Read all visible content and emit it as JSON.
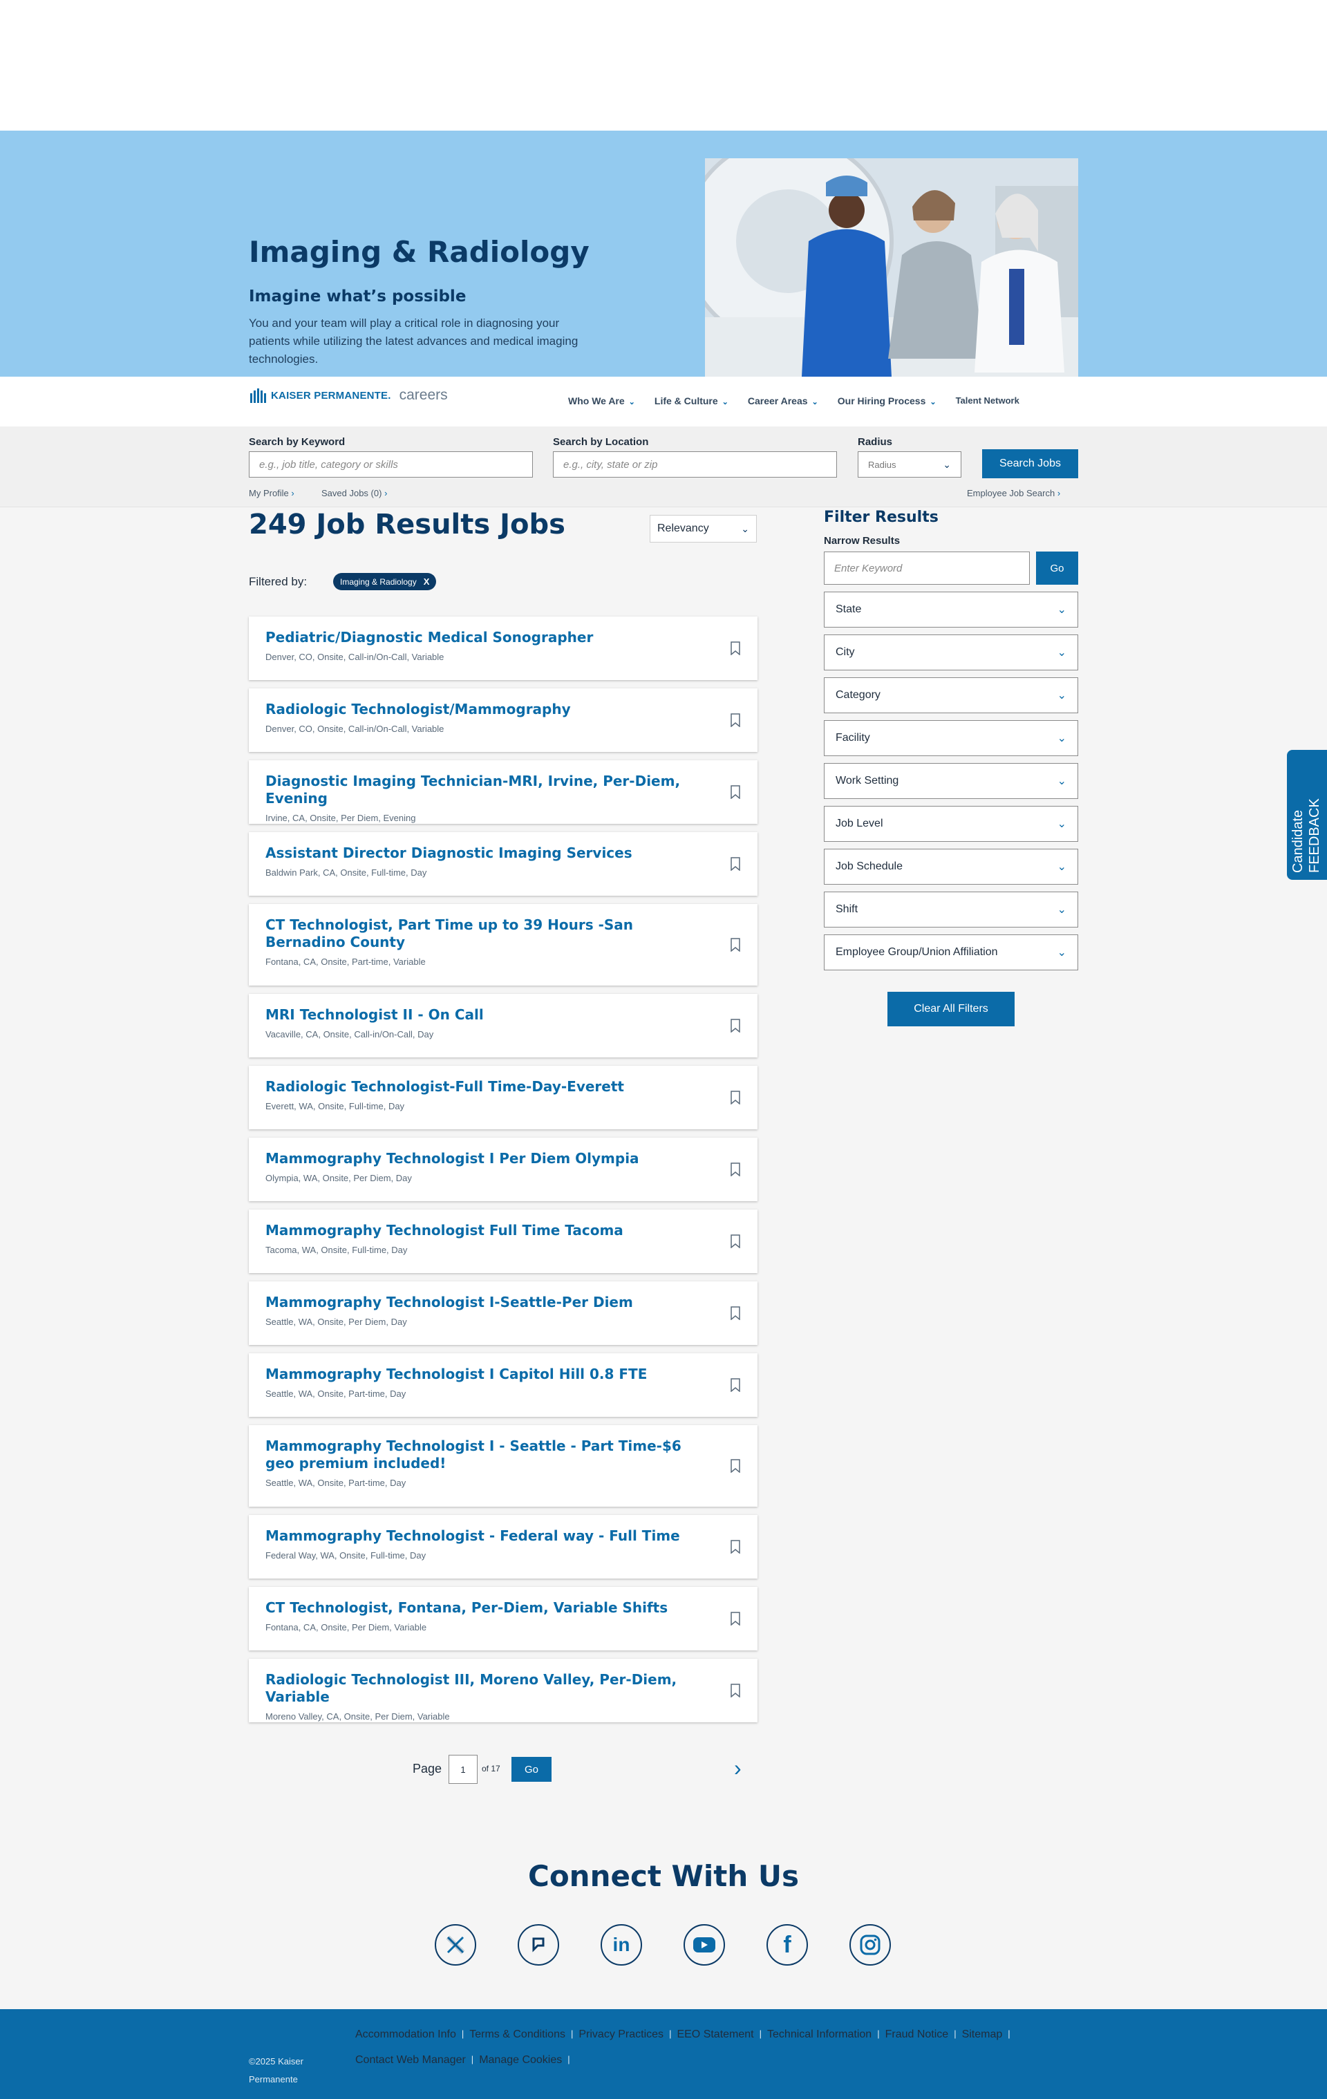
{
  "hero": {
    "title": "Imaging & Radiology",
    "subtitle": "Imagine what’s possible",
    "description": "You and your team will play a critical role in diagnosing your patients while utilizing the latest advances and medical imaging technologies."
  },
  "nav": {
    "logo_text": "KAISER PERMANENTE.",
    "logo_suffix": "careers",
    "links": [
      "Who We Are",
      "Life & Culture",
      "Career Areas",
      "Our Hiring Process",
      "Talent Network"
    ]
  },
  "search": {
    "keyword_label": "Search by Keyword",
    "keyword_placeholder": "e.g., job title, category or skills",
    "location_label": "Search by Location",
    "location_placeholder": "e.g., city, state or zip",
    "radius_label": "Radius",
    "radius_value": "Radius",
    "button": "Search Jobs",
    "my_profile": "My Profile",
    "saved_jobs": "Saved Jobs (0)",
    "employee_search": "Employee Job Search"
  },
  "results": {
    "heading": "249 Job Results Jobs",
    "sort_value": "Relevancy",
    "filtered_by": "Filtered by:",
    "chip": "Imaging & Radiology",
    "chip_close": "X"
  },
  "jobs": [
    {
      "title": "Pediatric/Diagnostic Medical Sonographer",
      "meta": "Denver, CO, Onsite, Call-in/On-Call, Variable"
    },
    {
      "title": "Radiologic Technologist/Mammography",
      "meta": "Denver, CO, Onsite, Call-in/On-Call, Variable"
    },
    {
      "title": "Diagnostic Imaging Technician-MRI, Irvine, Per-Diem, Evening",
      "meta": "Irvine, CA, Onsite, Per Diem, Evening"
    },
    {
      "title": "Assistant Director Diagnostic Imaging Services",
      "meta": "Baldwin Park, CA, Onsite, Full-time, Day"
    },
    {
      "title": "CT Technologist, Part Time up to 39 Hours -San Bernadino County",
      "meta": "Fontana, CA, Onsite, Part-time, Variable"
    },
    {
      "title": "MRI Technologist II - On Call",
      "meta": "Vacaville, CA, Onsite, Call-in/On-Call, Day"
    },
    {
      "title": "Radiologic Technologist-Full Time-Day-Everett",
      "meta": "Everett, WA, Onsite, Full-time, Day"
    },
    {
      "title": "Mammography Technologist I Per Diem Olympia",
      "meta": "Olympia, WA, Onsite, Per Diem, Day"
    },
    {
      "title": "Mammography Technologist Full Time Tacoma",
      "meta": "Tacoma, WA, Onsite, Full-time, Day"
    },
    {
      "title": "Mammography Technologist I-Seattle-Per Diem",
      "meta": "Seattle, WA, Onsite, Per Diem, Day"
    },
    {
      "title": "Mammography Technologist I Capitol Hill 0.8 FTE",
      "meta": "Seattle, WA, Onsite, Part-time, Day"
    },
    {
      "title": "Mammography Technologist I - Seattle - Part Time-$6 geo premium included!",
      "meta": "Seattle, WA, Onsite, Part-time, Day"
    },
    {
      "title": "Mammography Technologist - Federal way - Full Time",
      "meta": "Federal Way, WA, Onsite, Full-time, Day"
    },
    {
      "title": "CT Technologist, Fontana, Per-Diem, Variable Shifts",
      "meta": "Fontana, CA, Onsite, Per Diem, Variable"
    },
    {
      "title": "Radiologic Technologist III, Moreno Valley, Per-Diem, Variable",
      "meta": "Moreno Valley, CA, Onsite, Per Diem, Variable"
    }
  ],
  "pagination": {
    "label": "Page",
    "value": "1",
    "of": "of 17",
    "go": "Go"
  },
  "filters": {
    "title": "Filter Results",
    "narrow": "Narrow Results",
    "keyword_placeholder": "Enter Keyword",
    "go": "Go",
    "dropdowns": [
      "State",
      "City",
      "Category",
      "Facility",
      "Work Setting",
      "Job Level",
      "Job Schedule",
      "Shift",
      "Employee Group/Union Affiliation"
    ],
    "clear": "Clear All Filters"
  },
  "feedback": {
    "line1": "Candidate",
    "line2": "FEEDBACK",
    "icon": "[…]"
  },
  "connect": {
    "title": "Connect With Us",
    "icons": [
      "x-icon",
      "glassdoor-icon",
      "linkedin-icon",
      "youtube-icon",
      "facebook-icon",
      "instagram-icon"
    ]
  },
  "footer": {
    "copyright_1": "©2025 Kaiser",
    "copyright_2": "Permanente",
    "links_row1": [
      "Accommodation Info",
      "Terms & Conditions",
      "Privacy Practices",
      "EEO Statement",
      "Technical Information",
      "Fraud Notice",
      "Sitemap"
    ],
    "links_row2": [
      "Contact Web Manager",
      "Manage Cookies"
    ]
  },
  "colors": {
    "brand": "#0b6ba8",
    "navy": "#0b3a66",
    "hero_bg": "#93caef"
  }
}
